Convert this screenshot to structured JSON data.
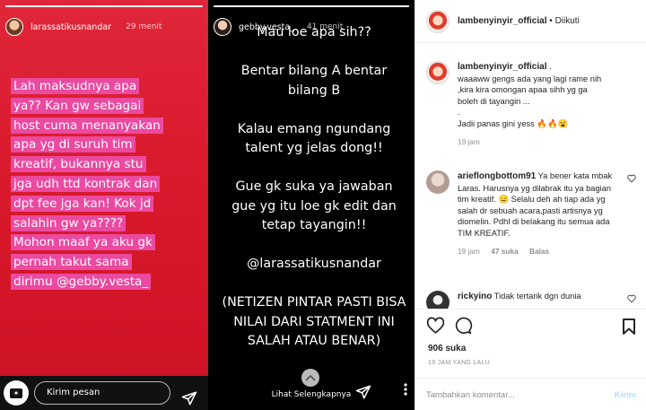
{
  "story1": {
    "username": "larassatikusnandar",
    "time": "29 menit",
    "lines": [
      "Lah maksudnya apa",
      "ya?? Kan gw sebagai",
      "host cuma menanyakan",
      "apa yg di suruh tim",
      "kreatif, bukannya stu",
      "jga udh ttd kontrak dan",
      "dpt fee jga kan! Kok jd",
      "salahin gw ya????",
      "Mohon maaf ya aku gk",
      "pernah takut sama",
      "dirimu @gebby.vesta_"
    ],
    "highlight_color": "#ea4aa0",
    "reply_placeholder": "Kirim pesan",
    "icons": {
      "camera": "camera-icon",
      "send": "send-icon"
    }
  },
  "story2": {
    "username": "gebby.vesta_",
    "time": "41 menit",
    "lines": [
      "Mau loe apa sih??",
      "",
      "Bentar bilang A bentar",
      "bilang B",
      "",
      "Kalau emang ngundang",
      "talent yg jelas dong!!",
      "",
      "Gue gk suka ya jawaban",
      "gue yg itu loe gk edit dan",
      "tetap tayangin!!",
      "",
      "@larassatikusnandar",
      "",
      "(NETIZEN PINTAR PASTI BISA",
      "NILAI DARI STATMENT INI",
      "SALAH ATAU BENAR)"
    ],
    "see_more": "Lihat Selengkapnya",
    "icons": {
      "see_more": "chevron-up-icon",
      "send": "send-icon",
      "more": "more-options-icon"
    }
  },
  "post": {
    "header": {
      "username": "lambenyinyir_official",
      "separator": "•",
      "follow_status": "Diikuti"
    },
    "caption": {
      "username": "lambenyinyir_official",
      "lines": [
        ".",
        "waaaww gengs ada yang lagi rame nih",
        ",kira kira omongan apaa sihh yg ga",
        "boleh di tayangin ...",
        ".",
        "Jadii panas gini yess 🔥🔥😮"
      ],
      "time": "19 jam"
    },
    "comments": [
      {
        "username": "arieflongbottom91",
        "text": "Ya bener kata mbak Laras. Harusnya yg dilabrak itu ya bagian tim kreatif. 😑 Selalu deh ah tiap ada yg salah dr sebuah acara,pasti artisnya yg diomelin. Pdhl di belakang itu semua ada TIM KREATIF.",
        "time": "19 jam",
        "likes": "47 suka",
        "reply": "Balas"
      },
      {
        "username": "rickyino",
        "text": "Tidak tertarik dgn dunia"
      }
    ],
    "likes_count": "906 suka",
    "date": "19 JAM YANG LALU",
    "comment_placeholder": "Tambahkan komentar...",
    "post_button": "Kirim",
    "colors": {
      "post_button": "#b2dffc",
      "meta": "#8e8e8e",
      "text": "#262626"
    }
  }
}
